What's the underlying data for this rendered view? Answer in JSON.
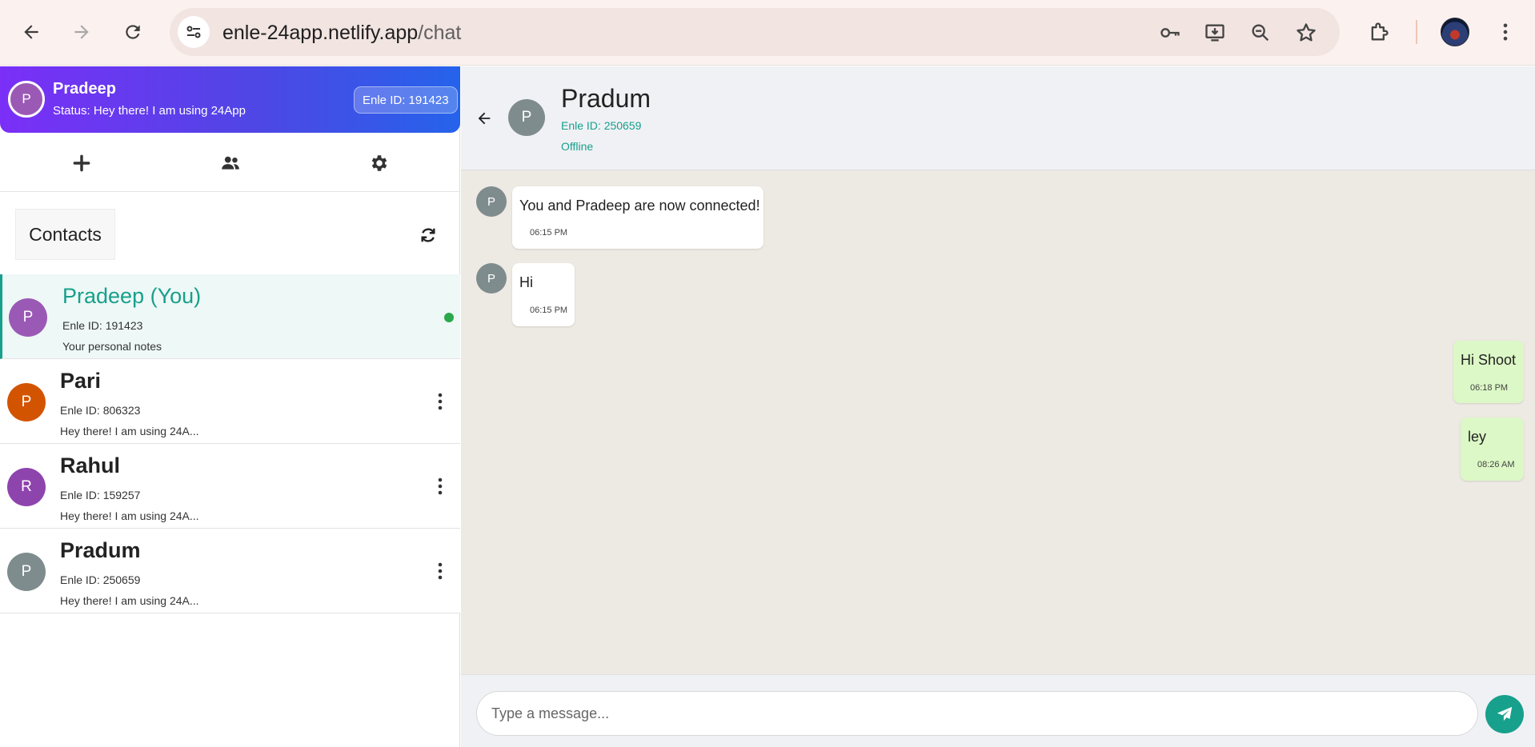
{
  "browser": {
    "url_host": "enle-24app.netlify.app",
    "url_path": "/chat"
  },
  "user": {
    "avatar_letter": "P",
    "name": "Pradeep",
    "status": "Status: Hey there! I am using 24App",
    "id_badge": "Enle ID: 191423"
  },
  "contacts_section": {
    "title": "Contacts",
    "items": [
      {
        "avatar_letter": "P",
        "name": "Pradeep (You)",
        "id": "Enle ID: 191423",
        "preview": "Your personal notes",
        "avatar_color": "#9b59b6",
        "online": true
      },
      {
        "avatar_letter": "P",
        "name": "Pari",
        "id": "Enle ID: 806323",
        "preview": "Hey there! I am using 24A...",
        "avatar_color": "#d35400"
      },
      {
        "avatar_letter": "R",
        "name": "Rahul",
        "id": "Enle ID: 159257",
        "preview": "Hey there! I am using 24A...",
        "avatar_color": "#8e44ad"
      },
      {
        "avatar_letter": "P",
        "name": "Pradum",
        "id": "Enle ID: 250659",
        "preview": "Hey there! I am using 24A...",
        "avatar_color": "#7f8c8d"
      }
    ]
  },
  "chat": {
    "peer": {
      "avatar_letter": "P",
      "name": "Pradum",
      "id": "Enle ID: 250659",
      "status": "Offline"
    },
    "messages": [
      {
        "direction": "in",
        "avatar_letter": "P",
        "text": "You and Pradeep are now connected!",
        "time": "06:15 PM"
      },
      {
        "direction": "in",
        "avatar_letter": "P",
        "text": "Hi",
        "time": "06:15 PM"
      },
      {
        "direction": "out",
        "text": "Hi Shoot",
        "time": "06:18 PM"
      },
      {
        "direction": "out",
        "text": "ley",
        "time": "08:26 AM"
      }
    ],
    "composer": {
      "placeholder": "Type a message..."
    }
  },
  "colors": {
    "accent": "#17a08c",
    "header_gradient_start": "#7b2ff7",
    "header_gradient_end": "#2563eb",
    "outgoing_bubble": "#dcf8c6",
    "chat_background": "#ede9e3"
  },
  "icons": {
    "toolbar": [
      "plus-icon",
      "users-icon",
      "gear-icon"
    ],
    "browser": [
      "back-arrow-icon",
      "forward-arrow-icon",
      "reload-icon",
      "site-settings-icon",
      "key-icon",
      "install-app-icon",
      "zoom-icon",
      "star-icon",
      "extensions-icon",
      "more-vertical-icon"
    ],
    "chat": [
      "back-arrow-icon",
      "refresh-icon",
      "kebab-menu-icon",
      "send-icon"
    ]
  }
}
